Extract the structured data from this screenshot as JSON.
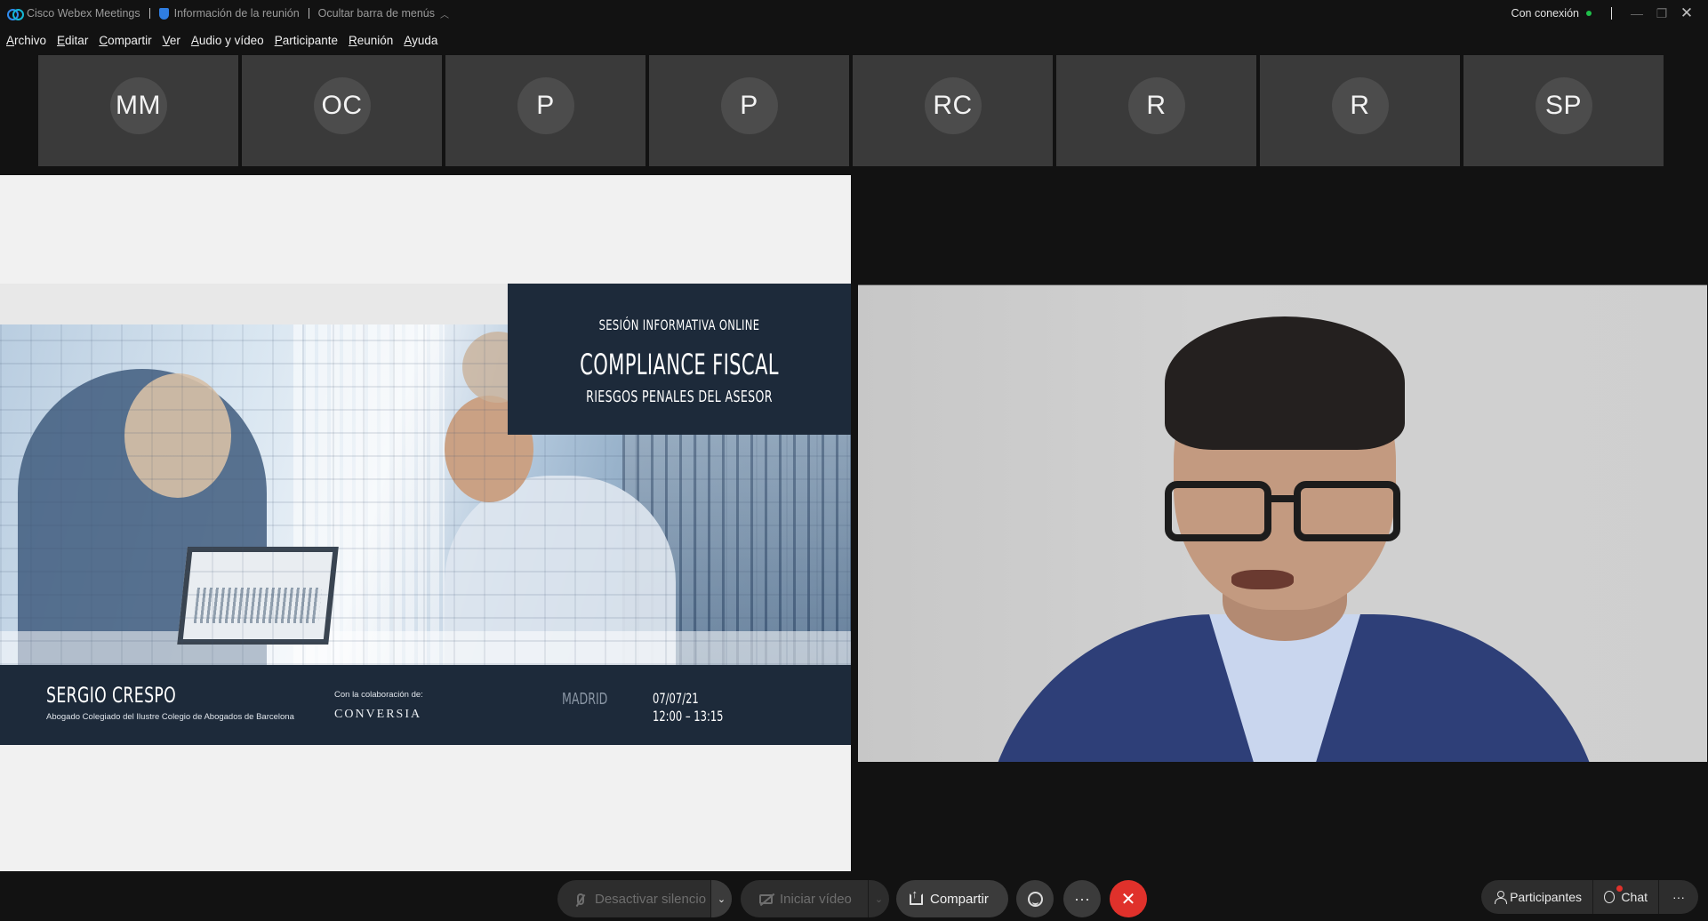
{
  "titlebar": {
    "app_name": "Cisco Webex Meetings",
    "meeting_info": "Información de la reunión",
    "hide_menu": "Ocultar barra de menús",
    "status": "Con conexión",
    "status_color": "#1fbf4a"
  },
  "menu": {
    "items": [
      {
        "first": "A",
        "rest": "rchivo"
      },
      {
        "first": "E",
        "rest": "ditar"
      },
      {
        "first": "C",
        "rest": "ompartir"
      },
      {
        "first": "V",
        "rest": "er"
      },
      {
        "first": "A",
        "rest": "udio y vídeo"
      },
      {
        "first": "P",
        "rest": "articipante"
      },
      {
        "first": "R",
        "rest": "eunión"
      },
      {
        "first": "A",
        "rest": "yuda"
      }
    ]
  },
  "participants": [
    {
      "initials": "MM"
    },
    {
      "initials": "OC"
    },
    {
      "initials": "P"
    },
    {
      "initials": "P"
    },
    {
      "initials": "RC"
    },
    {
      "initials": "R"
    },
    {
      "initials": "R"
    },
    {
      "initials": "SP"
    }
  ],
  "slide": {
    "session_type": "SESIÓN INFORMATIVA ONLINE",
    "title": "COMPLIANCE FISCAL",
    "subtitle": "RIESGOS PENALES DEL ASESOR",
    "speaker_name": "SERGIO CRESPO",
    "speaker_title": "Abogado Colegiado del Ilustre Colegio de Abogados de Barcelona",
    "collab_label": "Con la colaboración de:",
    "collab_logo": "CONVERSIA",
    "city": "MADRID",
    "date": "07/07/21",
    "time": "12:00 – 13:15"
  },
  "controls": {
    "mute_label": "Desactivar silencio",
    "video_label": "Iniciar vídeo",
    "share_label": "Compartir",
    "participants_label": "Participantes",
    "chat_label": "Chat",
    "leave_color": "#e0312b"
  }
}
